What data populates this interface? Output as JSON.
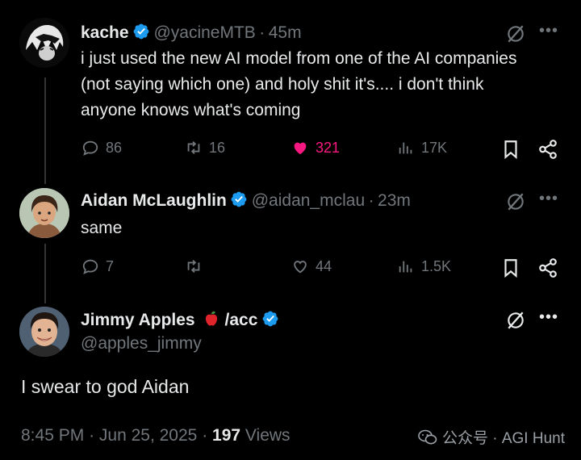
{
  "tweet1": {
    "name": "kache",
    "handle": "@yacineMTB",
    "time": "45m",
    "text": "i just used the new AI model from one of the AI companies (not saying which one) and holy shit it's.... i don't think anyone knows what's coming",
    "replies": "86",
    "reposts": "16",
    "likes": "321",
    "views": "17K"
  },
  "tweet2": {
    "name": "Aidan McLaughlin",
    "handle": "@aidan_mclau",
    "time": "23m",
    "text": "same",
    "replies": "7",
    "reposts": "",
    "likes": "44",
    "views": "1.5K"
  },
  "tweet3": {
    "name": "Jimmy Apples",
    "name_suffix": "/acc",
    "handle": "@apples_jimmy",
    "text": "I swear to god Aidan",
    "time": "8:45 PM",
    "date": "Jun 25, 2025",
    "views_count": "197",
    "views_label": "Views"
  },
  "separator": "·",
  "watermark": "公众号 · AGI Hunt",
  "colors": {
    "accent": "#1d9bf0",
    "like": "#f91880",
    "muted": "#71767b",
    "text": "#e7e9ea"
  }
}
